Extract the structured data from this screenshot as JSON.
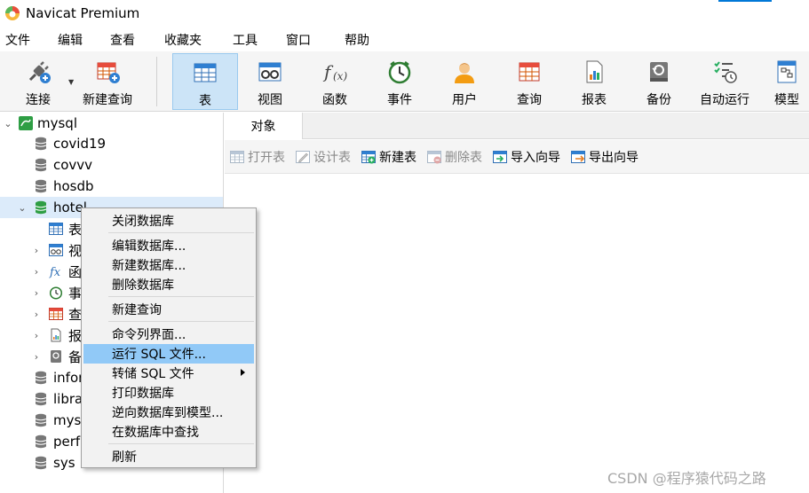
{
  "window": {
    "title": "Navicat Premium",
    "accent_color": "#0078d7"
  },
  "menu": [
    "文件",
    "编辑",
    "查看",
    "收藏夹",
    "工具",
    "窗口",
    "帮助"
  ],
  "toolbar": {
    "connect": "连接",
    "new_query": "新建查询",
    "table": "表",
    "view": "视图",
    "function": "函数",
    "event": "事件",
    "user": "用户",
    "query": "查询",
    "report": "报表",
    "backup": "备份",
    "automation": "自动运行",
    "model": "模型"
  },
  "tree": {
    "connection": "mysql",
    "databases": [
      "covid19",
      "covvv",
      "hosdb",
      "hotel"
    ],
    "hotel_children": [
      "表",
      "视",
      "函",
      "事",
      "查",
      "报",
      "备"
    ],
    "more_databases": [
      "infor",
      "libra",
      "mys",
      "perf",
      "sys"
    ]
  },
  "objects_tab": "对象",
  "object_toolbar": {
    "open_table": "打开表",
    "design_table": "设计表",
    "new_table": "新建表",
    "delete_table": "删除表",
    "import_wizard": "导入向导",
    "export_wizard": "导出向导"
  },
  "context_menu": {
    "close_db": "关闭数据库",
    "edit_db": "编辑数据库...",
    "new_db": "新建数据库...",
    "delete_db": "删除数据库",
    "new_query": "新建查询",
    "console": "命令列界面...",
    "run_sql": "运行 SQL 文件...",
    "dump_sql": "转储 SQL 文件",
    "print_db": "打印数据库",
    "reverse_model": "逆向数据库到模型...",
    "find_in_db": "在数据库中查找",
    "refresh": "刷新"
  },
  "watermark": "CSDN @程序猿代码之路"
}
